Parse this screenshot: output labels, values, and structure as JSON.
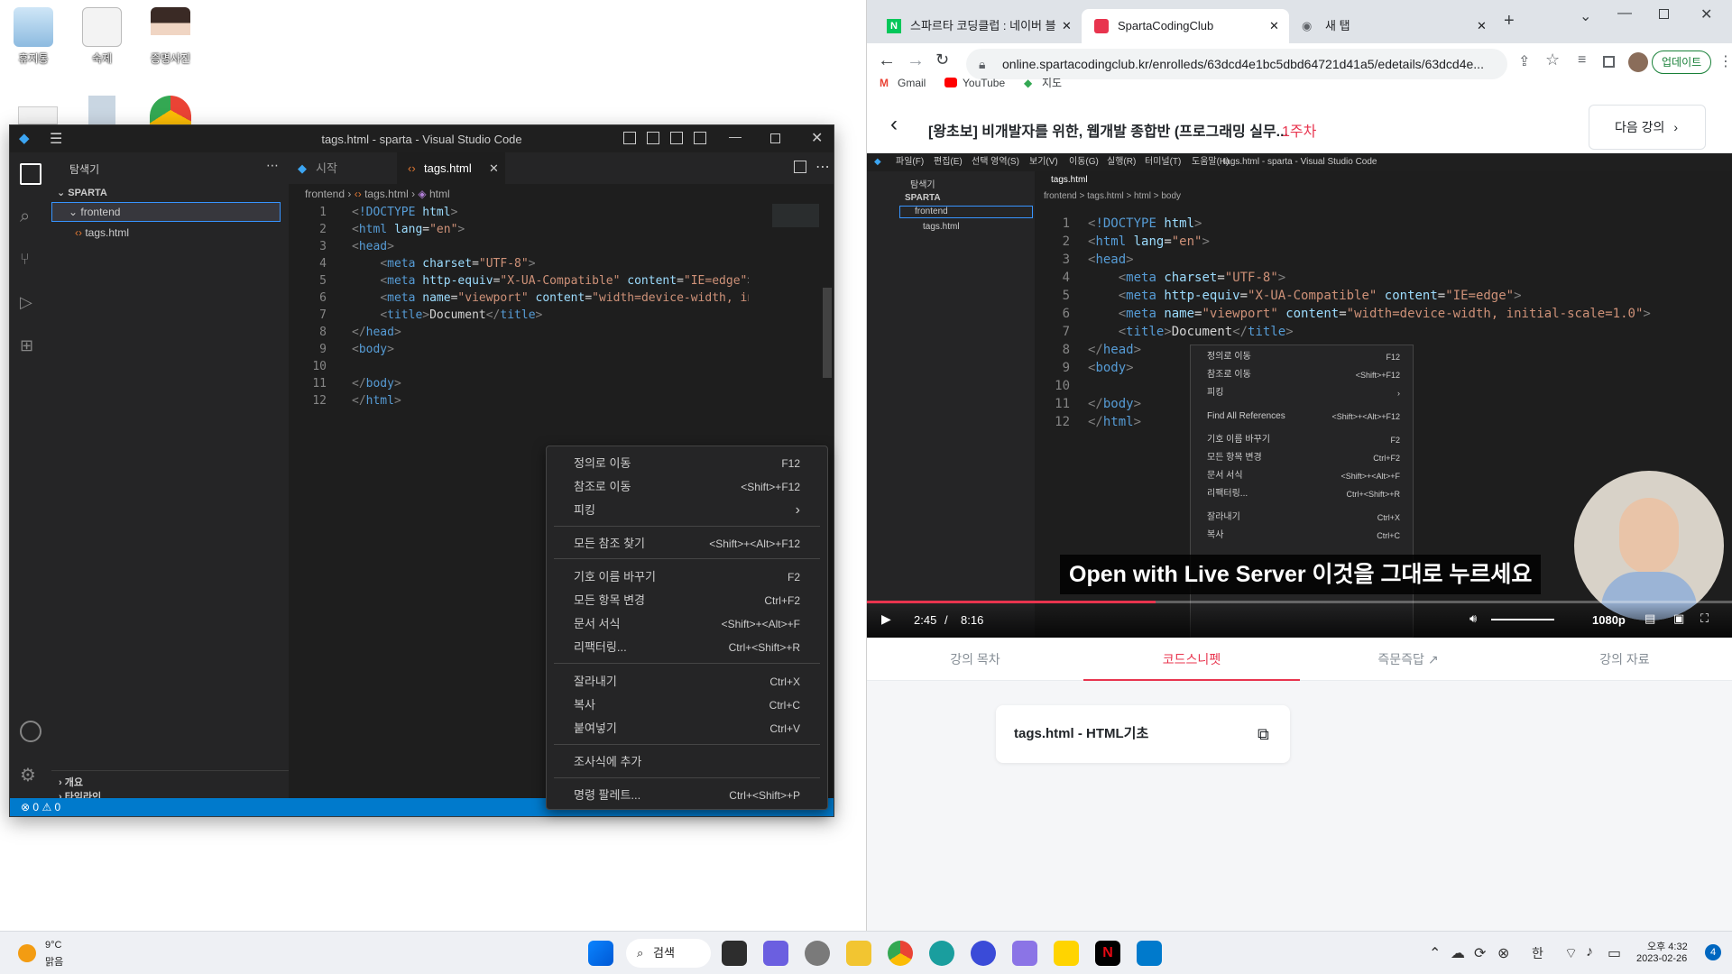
{
  "desktop": {
    "icons": [
      {
        "label": "휴지통"
      },
      {
        "label": "숙제"
      },
      {
        "label": "증명사진"
      }
    ]
  },
  "vscode": {
    "title": "tags.html - sparta - Visual Studio Code",
    "explorer": {
      "header": "탐색기",
      "root": "SPARTA",
      "folder": "frontend",
      "file": "tags.html",
      "outline": "개요",
      "timeline": "타임라인"
    },
    "tabs": [
      {
        "label": "시작"
      },
      {
        "label": "tags.html"
      }
    ],
    "breadcrumb": {
      "part1": "frontend",
      "part2": "tags.html",
      "part3": "html"
    },
    "line_numbers": [
      "1",
      "2",
      "3",
      "4",
      "5",
      "6",
      "7",
      "8",
      "9",
      "10",
      "11",
      "12"
    ],
    "status": {
      "problems": "0",
      "warnings": "0"
    }
  },
  "context_menu": {
    "items": [
      {
        "label": "정의로 이동",
        "key": "F12"
      },
      {
        "label": "참조로 이동",
        "key": "<Shift>+F12"
      },
      {
        "label": "피킹",
        "key": ""
      },
      {
        "label": "모든 참조 찾기",
        "key": "<Shift>+<Alt>+F12"
      },
      {
        "label": "기호 이름 바꾸기",
        "key": "F2"
      },
      {
        "label": "모든 항목 변경",
        "key": "Ctrl+F2"
      },
      {
        "label": "문서 서식",
        "key": "<Shift>+<Alt>+F"
      },
      {
        "label": "리팩터링...",
        "key": "Ctrl+<Shift>+R"
      },
      {
        "label": "잘라내기",
        "key": "Ctrl+X"
      },
      {
        "label": "복사",
        "key": "Ctrl+C"
      },
      {
        "label": "붙여넣기",
        "key": "Ctrl+V"
      },
      {
        "label": "조사식에 추가",
        "key": ""
      },
      {
        "label": "명령 팔레트...",
        "key": "Ctrl+<Shift>+P"
      }
    ]
  },
  "browser": {
    "tabs": [
      {
        "label": "스파르타 코딩클럽 : 네이버 블"
      },
      {
        "label": "SpartaCodingClub"
      },
      {
        "label": "새 탭"
      }
    ],
    "url": "online.spartacodingclub.kr/enrolleds/63dcd4e1bc5dbd64721d41a5/edetails/63dcd4e...",
    "update_label": "업데이트",
    "bookmarks": [
      {
        "label": "Gmail"
      },
      {
        "label": "YouTube"
      },
      {
        "label": "지도"
      }
    ],
    "course_title": "[왕초보] 비개발자를 위한, 웹개발 종합반 (프로그래밍 실무...",
    "week": "1주차",
    "next_lecture": "다음 강의",
    "video": {
      "mini_title": "tags.html - sparta - Visual Studio Code",
      "mini_menu": [
        "파일(F)",
        "편집(E)",
        "선택 영역(S)",
        "보기(V)",
        "이동(G)",
        "실행(R)",
        "터미널(T)",
        "도움말(H)"
      ],
      "mini_explorer_header": "탐색기",
      "mini_root": "SPARTA",
      "mini_folder": "frontend",
      "mini_file": "tags.html",
      "mini_tab": "tags.html",
      "mini_breadcrumb": "frontend > tags.html > html > body",
      "mini_menu_items": [
        {
          "label": "정의로 이동",
          "key": "F12"
        },
        {
          "label": "참조로 이동",
          "key": "<Shift>+F12"
        },
        {
          "label": "피킹",
          "key": ""
        },
        {
          "label": "Find All References",
          "key": "<Shift>+<Alt>+F12"
        },
        {
          "label": "기호 이름 바꾸기",
          "key": "F2"
        },
        {
          "label": "모든 항목 변경",
          "key": "Ctrl+F2"
        },
        {
          "label": "문서 서식",
          "key": "<Shift>+<Alt>+F"
        },
        {
          "label": "리팩터링...",
          "key": "Ctrl+<Shift>+R"
        },
        {
          "label": "잘라내기",
          "key": "Ctrl+X"
        },
        {
          "label": "복사",
          "key": "Ctrl+C"
        }
      ],
      "subtitle": "Open with Live Server 이것을 그대로 누르세요",
      "current_time": "2:45",
      "separator": "/",
      "duration": "8:16",
      "quality": "1080p",
      "progress_fraction": 0.333
    },
    "video_tabs": [
      {
        "label": "강의 목차"
      },
      {
        "label": "코드스니펫"
      },
      {
        "label": "즉문즉답"
      },
      {
        "label": "강의 자료"
      }
    ],
    "snippet_title": "tags.html - HTML기초"
  },
  "taskbar": {
    "weather_temp": "9°C",
    "weather_desc": "맑음",
    "search_label": "검색",
    "ime": "한",
    "time": "오후 4:32",
    "date": "2023-02-26",
    "notification_count": "4"
  }
}
